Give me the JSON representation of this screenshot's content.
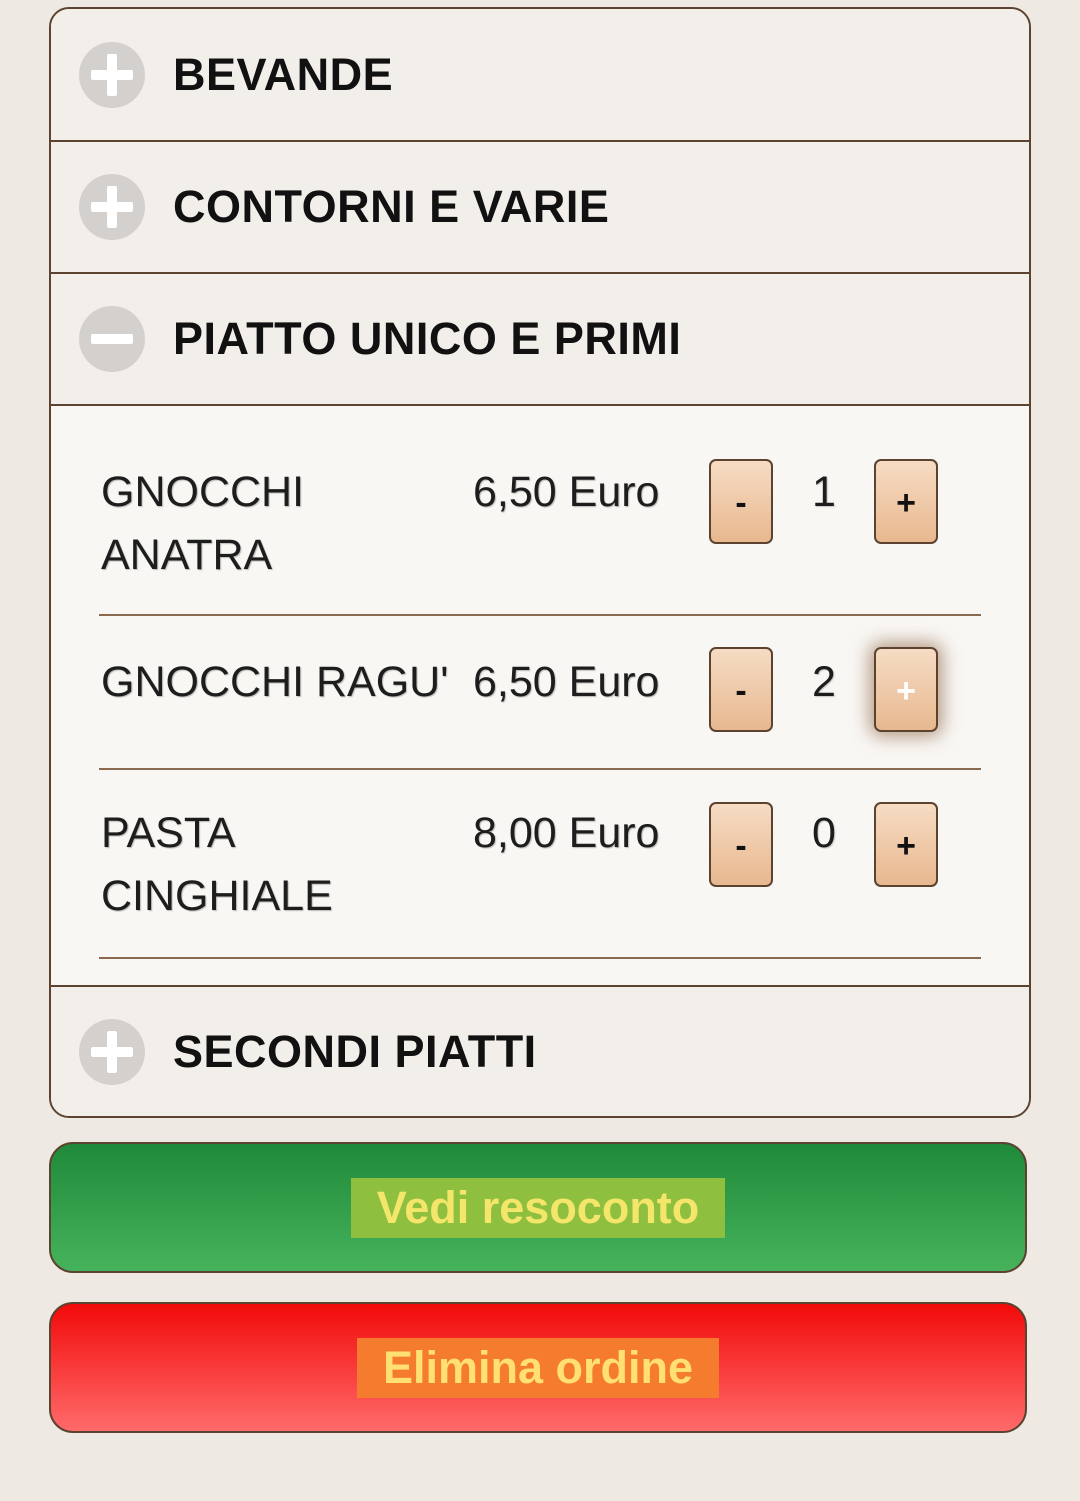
{
  "categories": [
    {
      "label": "BEVANDE",
      "icon": "plus-circle-icon",
      "expanded": false
    },
    {
      "label": "CONTORNI E VARIE",
      "icon": "plus-circle-icon",
      "expanded": false
    },
    {
      "label": "PIATTO UNICO E PRIMI",
      "icon": "minus-circle-icon",
      "expanded": true
    },
    {
      "label": "SECONDI PIATTI",
      "icon": "plus-circle-icon",
      "expanded": false
    }
  ],
  "items": [
    {
      "name_line1": "GNOCCHI",
      "name_line2": "ANATRA",
      "price": "6,50 Euro",
      "qty": "1",
      "minus": "-",
      "plus": "+"
    },
    {
      "name_line1": "GNOCCHI RAGU'",
      "name_line2": "",
      "price": "6,50 Euro",
      "qty": "2",
      "minus": "-",
      "plus": "+"
    },
    {
      "name_line1": "PASTA",
      "name_line2": "CINGHIALE",
      "price": "8,00 Euro",
      "qty": "0",
      "minus": "-",
      "plus": "+"
    }
  ],
  "actions": {
    "summary_label": "Vedi resoconto",
    "delete_label": "Elimina ordine"
  },
  "colors": {
    "border": "#5b4330",
    "button_fill": "#e8b88f",
    "summary_green": "#1f8a3a",
    "delete_red": "#f20a0a"
  }
}
